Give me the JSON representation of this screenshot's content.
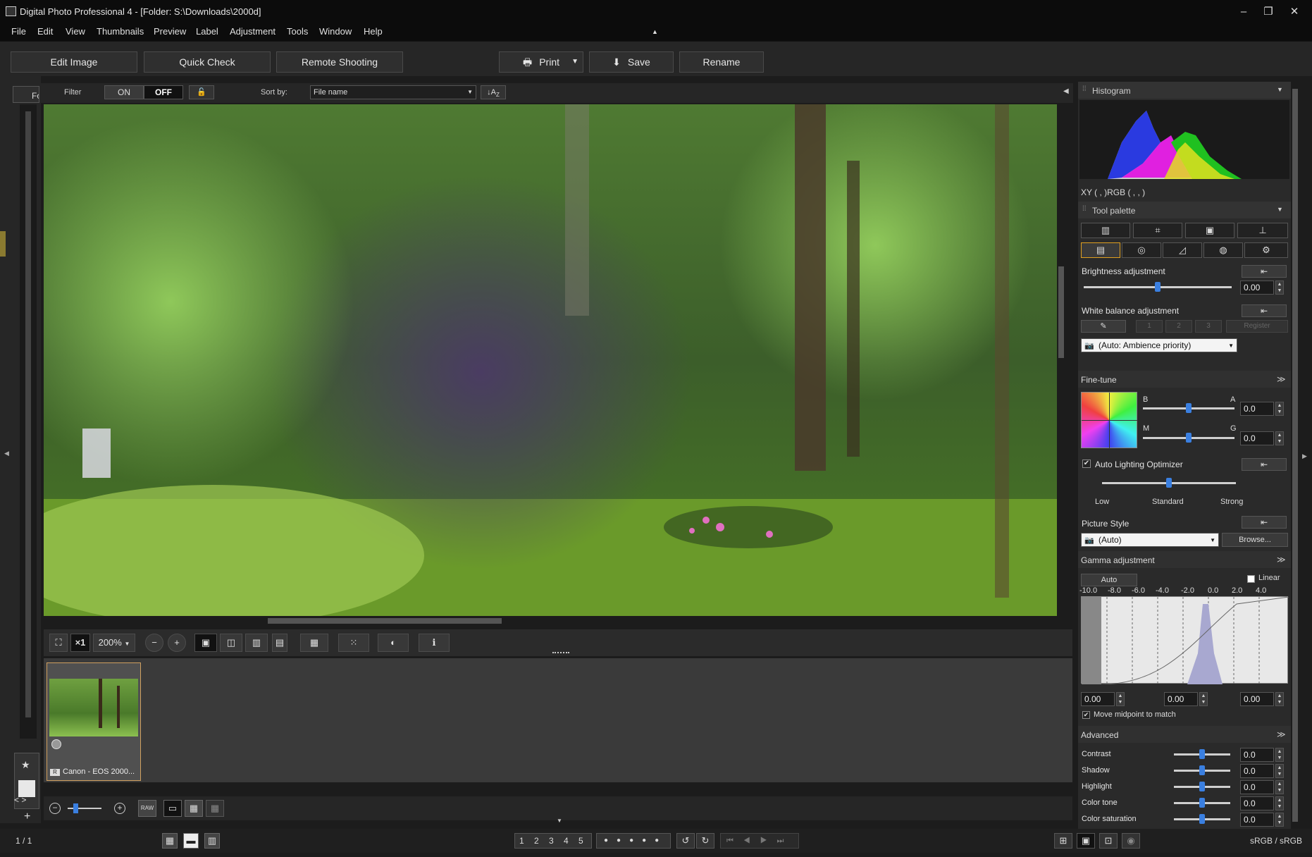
{
  "window": {
    "title": "Digital Photo Professional 4 - [Folder: S:\\Downloads\\2000d]",
    "minimize": "–",
    "restore": "❐",
    "close": "✕"
  },
  "menu": [
    "File",
    "Edit",
    "View",
    "Thumbnails",
    "Preview",
    "Label",
    "Adjustment",
    "Tools",
    "Window",
    "Help"
  ],
  "toolbar": {
    "edit_image": "Edit Image",
    "quick_check": "Quick Check",
    "remote_shooting": "Remote Shooting",
    "print": "Print",
    "save": "Save",
    "rename": "Rename"
  },
  "leftpanel": {
    "tab_label": "Fo"
  },
  "filter": {
    "label": "Filter",
    "on": "ON",
    "off": "OFF",
    "sort_by_label": "Sort by:",
    "sort_value": "File name",
    "sort_order_icon": "↓A",
    "sort_order_sub": "Z"
  },
  "viewtools": {
    "fit": "⛶",
    "x1": "×1",
    "zoom": "200%",
    "zoom_out": "−",
    "zoom_in": "+"
  },
  "thumbnail": {
    "label": "Canon - EOS 2000...",
    "badge": "R"
  },
  "statusbar": {
    "count": "1 / 1",
    "ratings": [
      "1",
      "2",
      "3",
      "4",
      "5"
    ],
    "colorspace": "sRGB / sRGB"
  },
  "right": {
    "histogram_title": "Histogram",
    "xy_readout": "XY (    ,     )RGB (    ,    ,    )",
    "tool_palette_title": "Tool palette",
    "brightness": {
      "label": "Brightness adjustment",
      "value": "0.00",
      "level": 0.5
    },
    "white_balance": {
      "label": "White balance adjustment",
      "presets": [
        "1",
        "2",
        "3"
      ],
      "register": "Register",
      "mode": "(Auto: Ambience priority)"
    },
    "finetune": {
      "label": "Fine-tune",
      "b": "B",
      "a": "A",
      "m": "M",
      "g": "G",
      "ba_value": "0.0",
      "mg_value": "0.0"
    },
    "alo": {
      "label": "Auto Lighting Optimizer",
      "low": "Low",
      "standard": "Standard",
      "strong": "Strong",
      "level": 0.5
    },
    "picture_style": {
      "label": "Picture Style",
      "value": "(Auto)",
      "browse": "Browse..."
    },
    "gamma": {
      "label": "Gamma adjustment",
      "auto": "Auto",
      "linear": "Linear",
      "ticks": [
        "-10.0",
        "-8.0",
        "-6.0",
        "-4.0",
        "-2.0",
        "0.0",
        "2.0",
        "4.0"
      ],
      "black": "0.00",
      "mid": "0.00",
      "white": "0.00",
      "move_midpoint": "Move midpoint to match"
    },
    "advanced": {
      "label": "Advanced",
      "rows": [
        {
          "name": "Contrast",
          "value": "0.0"
        },
        {
          "name": "Shadow",
          "value": "0.0"
        },
        {
          "name": "Highlight",
          "value": "0.0"
        },
        {
          "name": "Color tone",
          "value": "0.0"
        },
        {
          "name": "Color saturation",
          "value": "0.0"
        }
      ]
    }
  },
  "colors": {
    "accent": "#3a7fe0",
    "selection_border": "#d0a060",
    "background": "#262626"
  }
}
